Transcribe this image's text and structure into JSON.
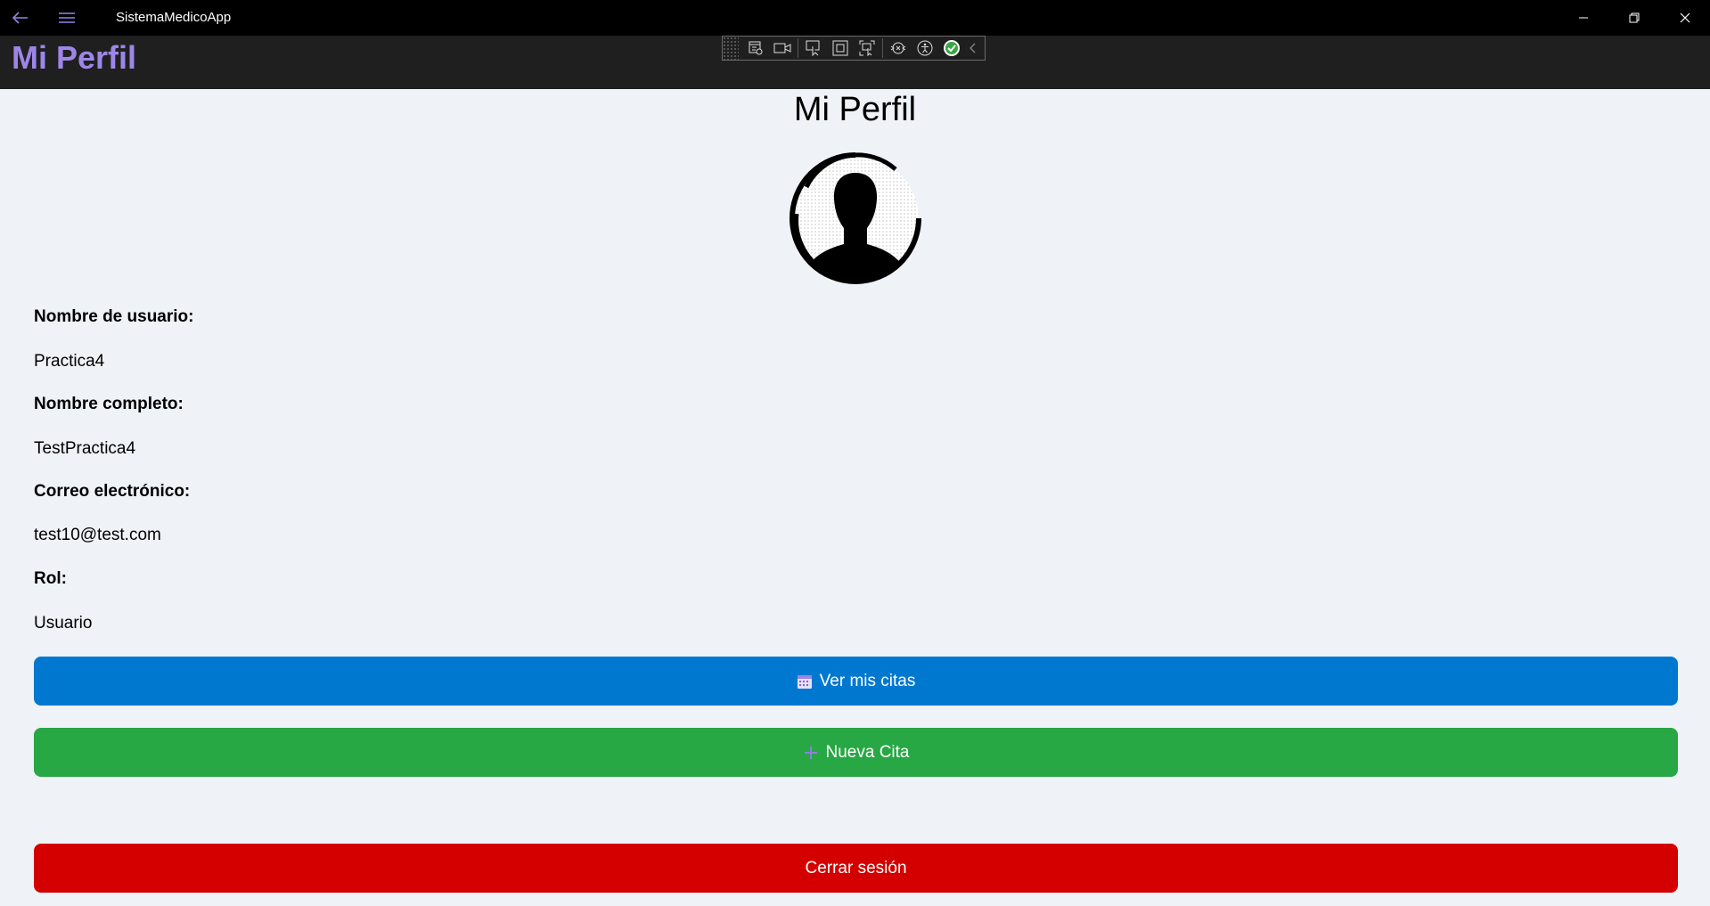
{
  "window": {
    "app_title": "SistemaMedicoApp",
    "back_icon": "arrow-left-icon",
    "menu_icon": "hamburger-icon",
    "controls": [
      "minimize-icon",
      "restore-icon",
      "close-icon"
    ]
  },
  "header": {
    "title": "Mi Perfil",
    "accent_color": "#9d86e8"
  },
  "debug_toolbar": {
    "icons": [
      "live-visual-tree-icon",
      "record-icon",
      "select-element-icon",
      "display-layout-adorners-icon",
      "track-focus-icon",
      "hot-reload-icon",
      "accessibility-icon",
      "checkmark-icon",
      "collapse-chevron-icon"
    ]
  },
  "profile": {
    "page_title": "Mi Perfil",
    "avatar_icon": "user-avatar-icon",
    "fields": [
      {
        "label": "Nombre de usuario:",
        "value": "Practica4"
      },
      {
        "label": "Nombre completo:",
        "value": "TestPractica4"
      },
      {
        "label": "Correo electrónico:",
        "value": "test10@test.com"
      },
      {
        "label": "Rol:",
        "value": "Usuario"
      }
    ]
  },
  "actions": {
    "view_appointments": {
      "label": "Ver mis citas",
      "icon": "calendar-icon",
      "color": "#0078d0"
    },
    "new_appointment": {
      "label": "Nueva Cita",
      "icon": "plus-icon",
      "color": "#28a745"
    },
    "logout": {
      "label": "Cerrar sesión",
      "color": "#d40000"
    }
  }
}
